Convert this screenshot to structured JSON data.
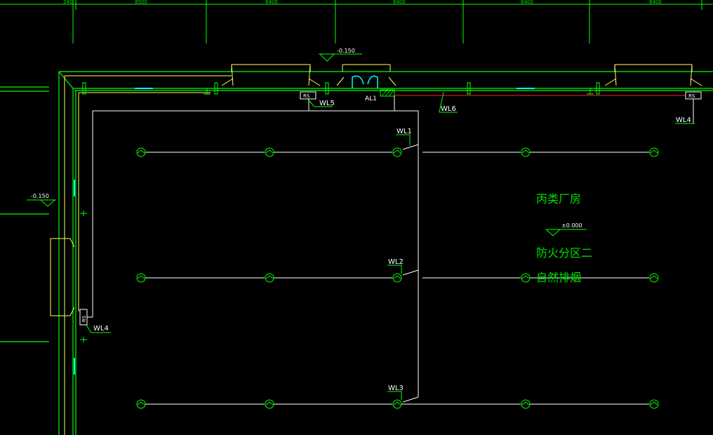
{
  "dimensions_top": [
    "240",
    "8500",
    "8400",
    "8400",
    "8400",
    "8400"
  ],
  "levels": {
    "top": "-0.150",
    "left": "-0.150",
    "floor": "±0.000"
  },
  "panel_label": "AL1",
  "rs_label": "RS",
  "circuits": {
    "wl1": "WL1",
    "wl2": "WL2",
    "wl3": "WL3",
    "wl4": "WL4",
    "wl5": "WL5",
    "wl6": "WL6"
  },
  "room": {
    "name": "丙类厂房",
    "zone": "防火分区二",
    "smoke": "自然排烟"
  },
  "colors": {
    "background": "#000000",
    "wall": "#00ff00",
    "annotation": "#00e000",
    "wiring": "#ffffff",
    "outline": "#ffff66",
    "window": "#00ffff",
    "fire_line": "#ff2020"
  }
}
